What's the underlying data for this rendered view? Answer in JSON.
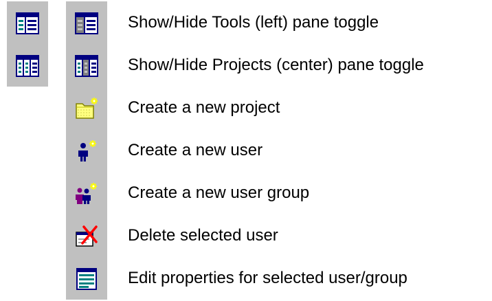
{
  "legend": {
    "items": [
      {
        "icon": "tools-pane-toggle-icon",
        "label": "Show/Hide Tools (left) pane toggle"
      },
      {
        "icon": "projects-pane-toggle-icon",
        "label": "Show/Hide Projects (center) pane toggle"
      },
      {
        "icon": "new-project-icon",
        "label": "Create a new project"
      },
      {
        "icon": "new-user-icon",
        "label": "Create a new user"
      },
      {
        "icon": "new-user-group-icon",
        "label": "Create a new user group"
      },
      {
        "icon": "delete-user-icon",
        "label": "Delete selected user"
      },
      {
        "icon": "edit-properties-icon",
        "label": "Edit properties for selected user/group"
      }
    ]
  },
  "colors": {
    "icon_background": "#c0c0c0",
    "window_blue": "#000080",
    "folder_yellow": "#ffff80",
    "user_blue": "#000080",
    "user_purple": "#800080",
    "delete_red": "#ff0000",
    "properties_teal": "#008080",
    "sparkle_yellow": "#ffff00"
  }
}
